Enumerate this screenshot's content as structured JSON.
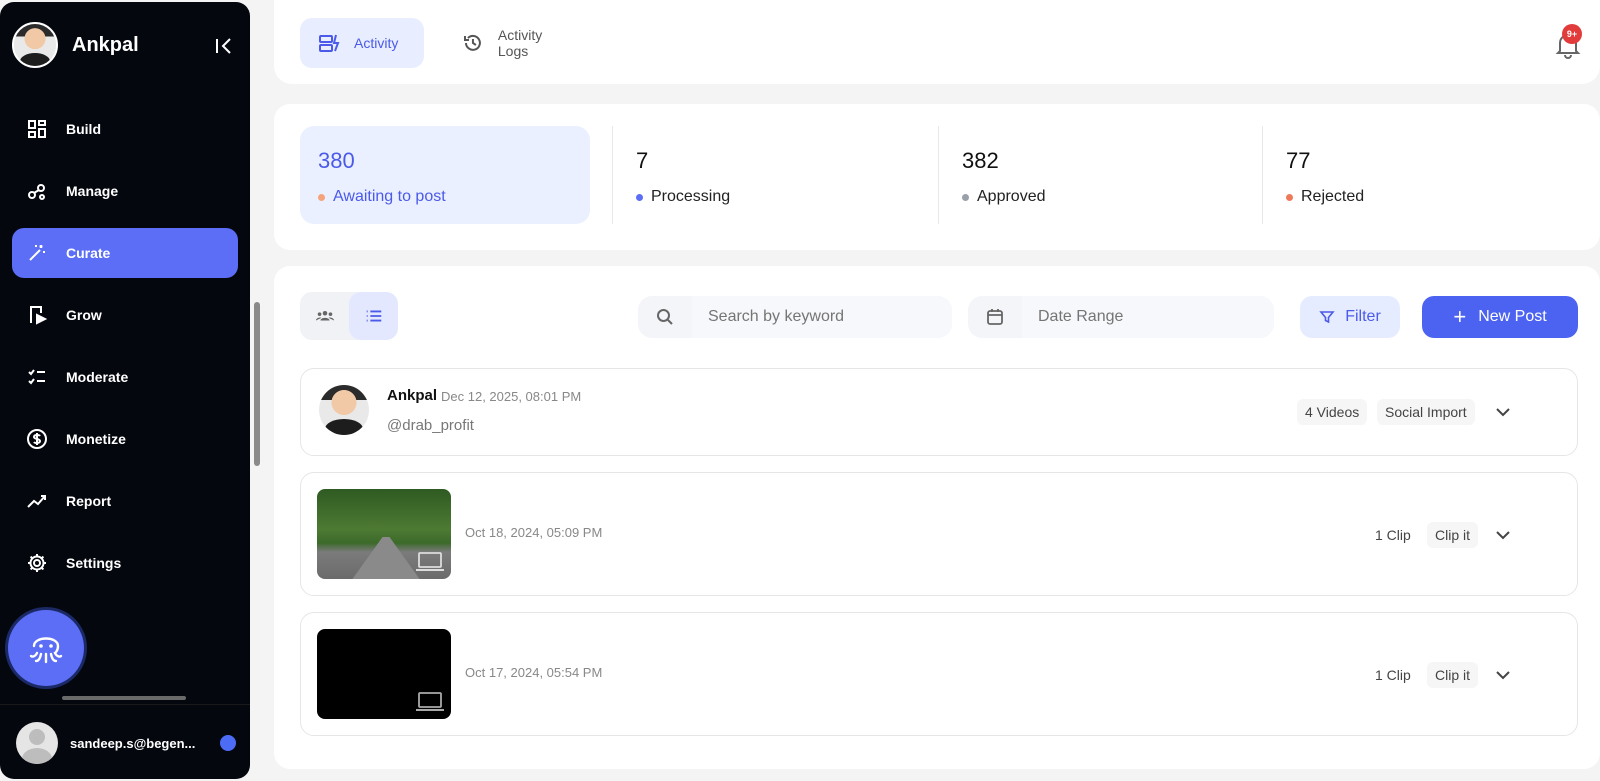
{
  "app": {
    "brand_name": "Ankpal",
    "accent": "#5b6ef5"
  },
  "sidebar": {
    "items": [
      {
        "label": "Build",
        "icon": "grid-icon",
        "active": false
      },
      {
        "label": "Manage",
        "icon": "nodes-icon",
        "active": false
      },
      {
        "label": "Curate",
        "icon": "magic-wand-icon",
        "active": true
      },
      {
        "label": "Grow",
        "icon": "play-square-icon",
        "active": false
      },
      {
        "label": "Moderate",
        "icon": "checklist-icon",
        "active": false
      },
      {
        "label": "Monetize",
        "icon": "dollar-icon",
        "active": false
      },
      {
        "label": "Report",
        "icon": "trend-icon",
        "active": false
      },
      {
        "label": "Settings",
        "icon": "gear-icon",
        "active": false
      }
    ],
    "user_email": "sandeep.s@begen..."
  },
  "header": {
    "tabs": [
      {
        "label": "Activity",
        "icon": "activity-icon",
        "active": true
      },
      {
        "label": "Activity Logs",
        "icon": "history-icon",
        "active": false
      }
    ],
    "notification_badge": "9+"
  },
  "stats": [
    {
      "value": "380",
      "label": "Awaiting to post",
      "dot_color": "#f4a37a",
      "active": true
    },
    {
      "value": "7",
      "label": "Processing",
      "dot_color": "#5b6ef5",
      "active": false
    },
    {
      "value": "382",
      "label": "Approved",
      "dot_color": "#9aa0aa",
      "active": false
    },
    {
      "value": "77",
      "label": "Rejected",
      "dot_color": "#ef7a5a",
      "active": false
    }
  ],
  "toolbar": {
    "search_placeholder": "Search by keyword",
    "date_placeholder": "Date Range",
    "filter_label": "Filter",
    "new_post_label": "New Post",
    "new_post_plus": "+"
  },
  "posts": [
    {
      "author": "Ankpal",
      "date": "Dec 12, 2025, 08:01 PM",
      "handle": "@drab_profit",
      "count_label": "4 Videos",
      "source_label": "Social Import"
    }
  ],
  "videos": [
    {
      "date": "Oct 18, 2024, 05:09 PM",
      "count_label": "1 Clip",
      "action_label": "Clip it",
      "thumbnail": "forest-road"
    },
    {
      "date": "Oct 17, 2024, 05:54 PM",
      "count_label": "1 Clip",
      "action_label": "Clip it",
      "thumbnail": "black"
    }
  ]
}
